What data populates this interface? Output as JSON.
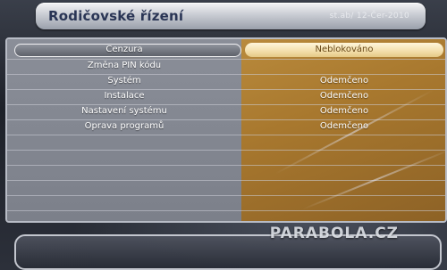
{
  "header": {
    "title": "Rodičovské řízení",
    "date": "st.ab/ 12-Čer-2010"
  },
  "menu": {
    "selected_index": 0,
    "rows": [
      {
        "label": "Cenzura",
        "value": "Neblokováno"
      },
      {
        "label": "Změna PIN kódu",
        "value": ""
      },
      {
        "label": "Systém",
        "value": "Odemčeno"
      },
      {
        "label": "Instalace",
        "value": "Odemčeno"
      },
      {
        "label": "Nastavení systému",
        "value": "Odemčeno"
      },
      {
        "label": "Oprava programů",
        "value": "Odemčeno"
      }
    ]
  },
  "watermark": "PARABOLA.CZ",
  "colors": {
    "left_column": "#7c808a",
    "right_column": "#a8782e",
    "selected_value_bg": "#f3deaa"
  }
}
